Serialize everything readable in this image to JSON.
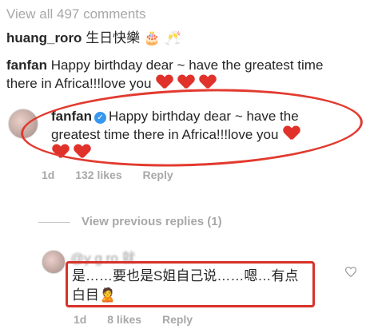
{
  "view_all": "View all 497 comments",
  "comments": [
    {
      "user": "huang_roro",
      "text": "生日快樂",
      "emoji": "🎂 🥂"
    },
    {
      "user": "fanfan",
      "text": "Happy birthday dear ~ have the  greatest time there in Africa!!!love you"
    }
  ],
  "highlighted": {
    "user": "fanfan",
    "line1": "Happy birthday dear ~ have the",
    "line2": "greatest time there in Africa!!!love you",
    "age": "1d",
    "likes": "132 likes",
    "reply": "Reply"
  },
  "view_previous": "View previous replies (1)",
  "reply_comment": {
    "blurred_line": "@y       g  ro 就",
    "line2": "是……要也是S姐自己说……嗯…有点",
    "line3": "白目",
    "emoji": "🙎",
    "age": "1d",
    "likes": "8 likes",
    "reply": "Reply"
  },
  "colors": {
    "accent": "#e23a2f",
    "verified": "#3897f0",
    "muted": "#a8a8a8"
  }
}
